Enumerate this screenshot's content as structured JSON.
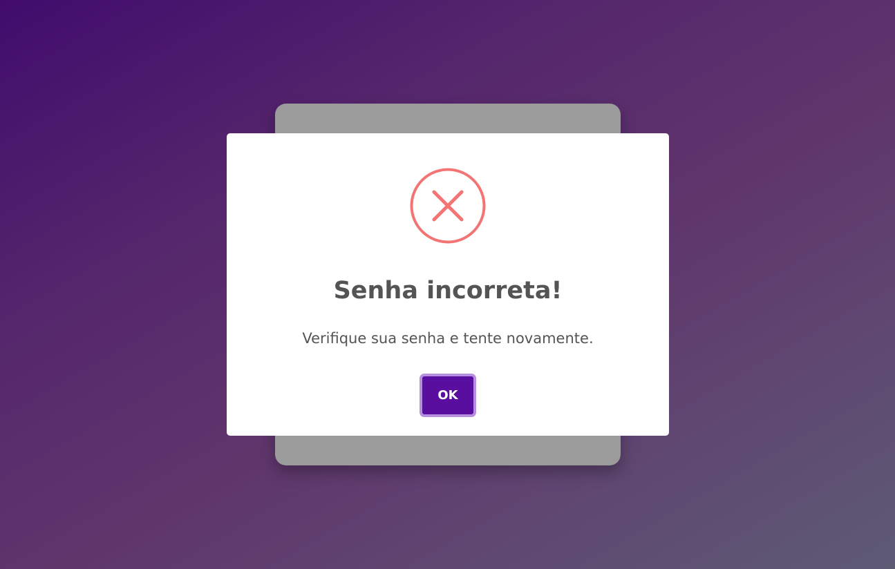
{
  "colors": {
    "background_start": "#410c6d",
    "background_end": "#5d5a74",
    "backdrop_card": "#9b9b9b",
    "modal_background": "#ffffff",
    "error_icon": "#f27474",
    "text": "#545454",
    "button_background": "#5a0ea0",
    "button_border": "#b68fde",
    "button_text": "#ffffff"
  },
  "dialog": {
    "icon": "error-x-icon",
    "title": "Senha incorreta!",
    "message": "Verifique sua senha e tente novamente.",
    "confirm_label": "OK"
  }
}
